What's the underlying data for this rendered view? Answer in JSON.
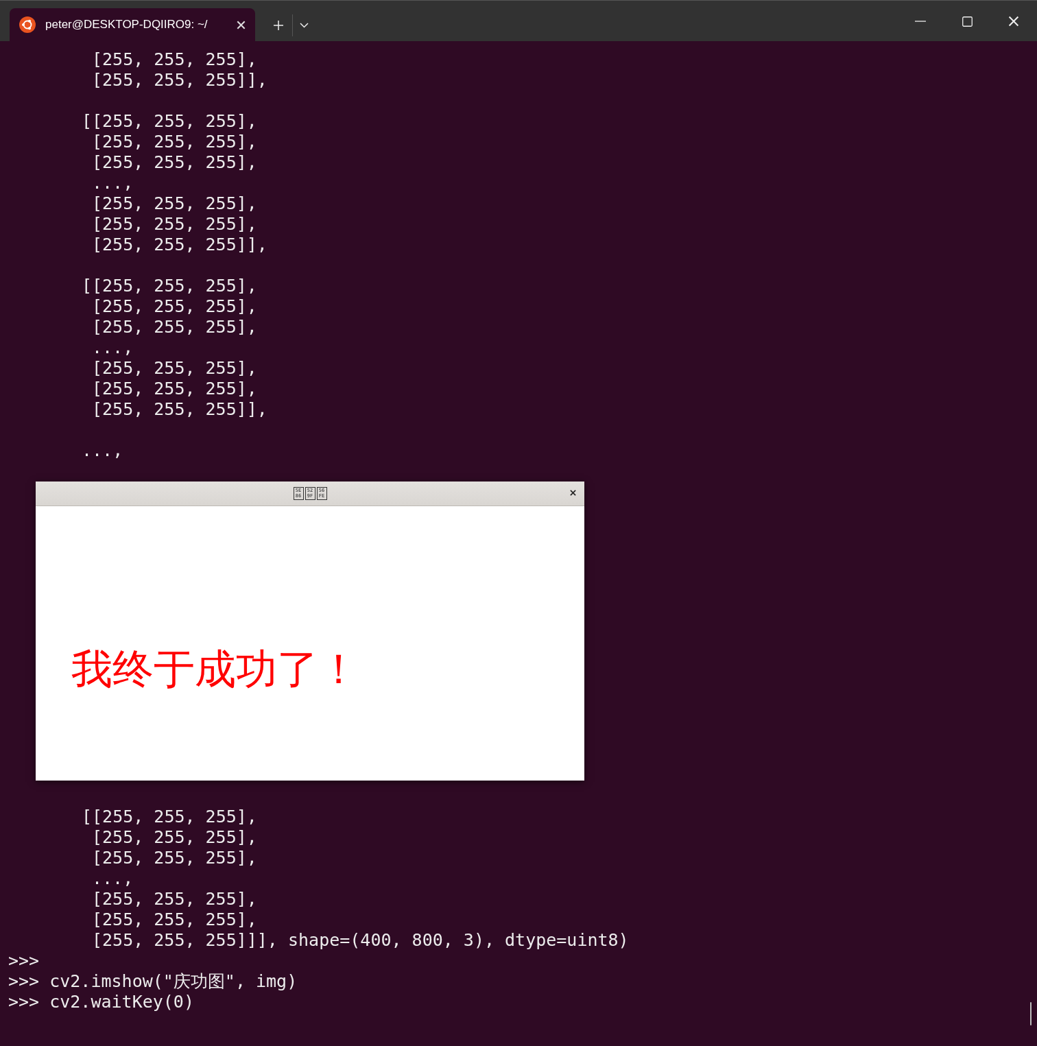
{
  "tab": {
    "title": "peter@DESKTOP-DQIIRO9: ~/",
    "selected": true
  },
  "terminal": {
    "blocks_before": [
      {
        "rows": [
          "[255, 255, 255],",
          "[255, 255, 255]],"
        ]
      },
      {
        "first": "[[255, 255, 255],",
        "rows": [
          "[255, 255, 255],",
          "[255, 255, 255],",
          "...,",
          "[255, 255, 255],",
          "[255, 255, 255],",
          "[255, 255, 255]],"
        ]
      },
      {
        "first": "[[255, 255, 255],",
        "rows": [
          "[255, 255, 255],",
          "[255, 255, 255],",
          "...,",
          "[255, 255, 255],",
          "[255, 255, 255],",
          "[255, 255, 255]],"
        ]
      },
      {
        "first": "...,"
      }
    ],
    "blocks_after": [
      {
        "first": "[[255, 255, 255],",
        "rows": [
          "[255, 255, 255],",
          "[255, 255, 255],",
          "...,",
          "[255, 255, 255],",
          "[255, 255, 255],",
          "[255, 255, 255]]], shape=(400, 800, 3), dtype=uint8)"
        ]
      }
    ],
    "prompt_lines": [
      {
        "prompt": ">>>"
      },
      {
        "prompt": ">>>",
        "command": "cv2.imshow(\"庆功图\", img)"
      },
      {
        "prompt": ">>>",
        "command": "cv2.waitKey(0)"
      }
    ]
  },
  "image_window": {
    "title_glyphs": [
      [
        "5E",
        "86"
      ],
      [
        "52",
        "9F"
      ],
      [
        "56",
        "FE"
      ]
    ],
    "image_text": "我终于成功了！"
  }
}
